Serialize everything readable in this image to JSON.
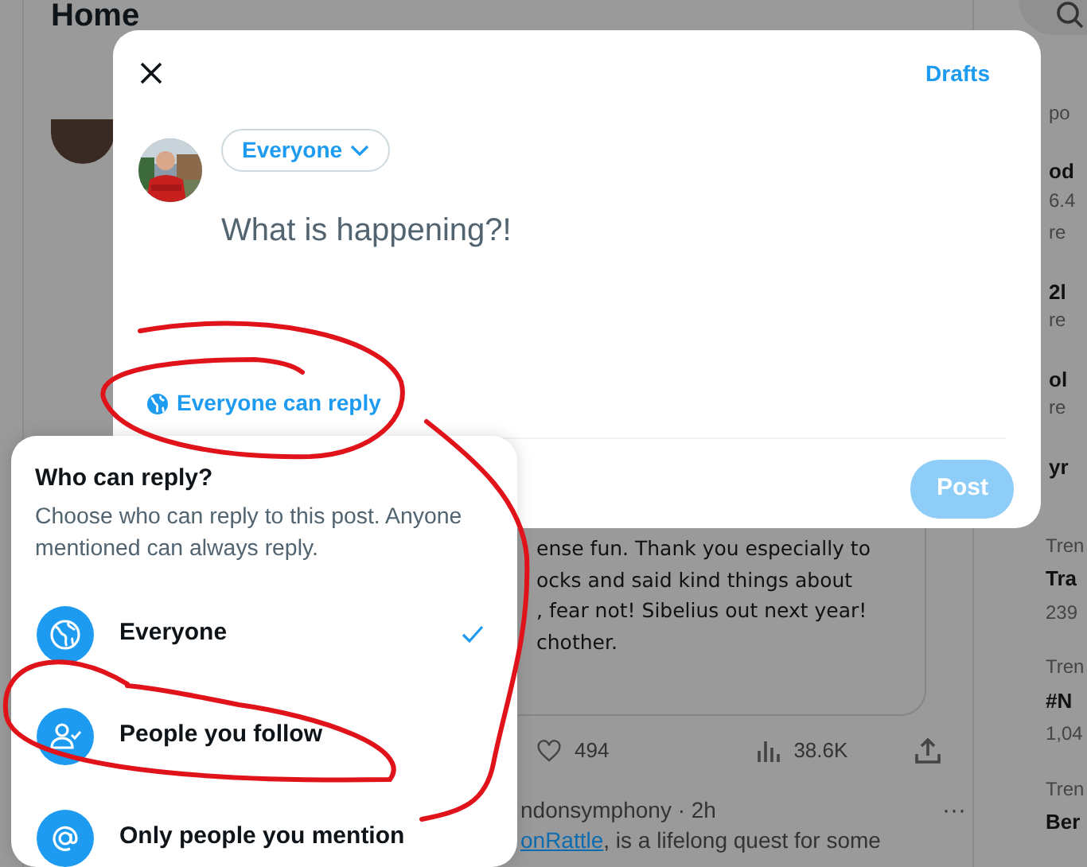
{
  "feed": {
    "title": "Home",
    "post_lines": [
      "ense fun. Thank you especially to",
      "ocks and said kind things about",
      ", fear not! Sibelius out next year!",
      "chother."
    ],
    "likes": "494",
    "views": "38.6K",
    "next_post": {
      "header": "ndonsymphony · 2h",
      "more": "···",
      "link": "onRattle",
      "text": ", is a lifelong quest for some"
    }
  },
  "sidebar": {
    "upper_items": [
      {
        "kind": "caption",
        "text": "po"
      },
      {
        "kind": "title",
        "text": "od"
      },
      {
        "kind": "count",
        "text": "6.4"
      },
      {
        "kind": "caption",
        "text": "re"
      },
      {
        "kind": "title",
        "text": "2l"
      },
      {
        "kind": "caption",
        "text": "re"
      },
      {
        "kind": "title",
        "text": "ol"
      },
      {
        "kind": "caption",
        "text": "re"
      },
      {
        "kind": "title",
        "text": "yr"
      }
    ],
    "items": [
      {
        "kind": "caption",
        "text": "Tren"
      },
      {
        "kind": "title",
        "text": "Tra"
      },
      {
        "kind": "count",
        "text": "239"
      },
      {
        "kind": "caption",
        "text": "Tren"
      },
      {
        "kind": "title",
        "text": "#N"
      },
      {
        "kind": "count",
        "text": "1,04"
      },
      {
        "kind": "caption",
        "text": "Tren"
      },
      {
        "kind": "title",
        "text": "Ber"
      }
    ]
  },
  "composer": {
    "drafts": "Drafts",
    "audience": "Everyone",
    "placeholder": "What is happening?!",
    "reply_setting": "Everyone can reply",
    "post_button": {
      "label": "Post",
      "disabled": true
    }
  },
  "reply_menu": {
    "title": "Who can reply?",
    "subtitle": "Choose who can reply to this post. Anyone mentioned can always reply.",
    "options": [
      {
        "kind": "globe",
        "label": "Everyone",
        "selected": true
      },
      {
        "kind": "follow",
        "label": "People you follow",
        "selected": false
      },
      {
        "kind": "mention",
        "label": "Only people you mention",
        "selected": false
      }
    ]
  }
}
